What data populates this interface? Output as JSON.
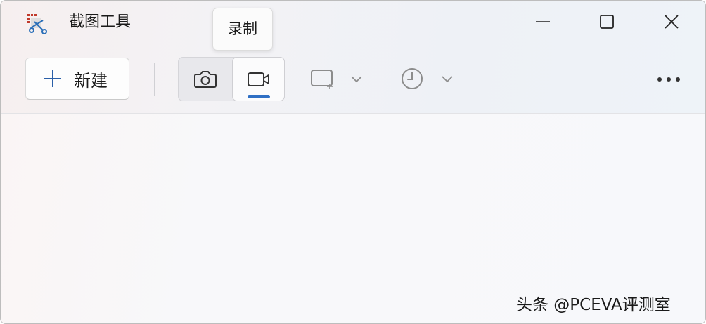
{
  "window": {
    "title": "截图工具",
    "app_icon": "snipping-tool-icon",
    "controls": {
      "minimize_icon": "minimize-icon",
      "maximize_icon": "maximize-icon",
      "close_icon": "close-icon"
    }
  },
  "tooltip": {
    "text": "录制"
  },
  "toolbar": {
    "new_label": "新建",
    "new_icon": "plus-icon",
    "mode": {
      "options": [
        {
          "name": "screenshot",
          "icon": "camera-icon",
          "selected": false
        },
        {
          "name": "record",
          "icon": "video-camera-icon",
          "selected": true
        }
      ]
    },
    "snip_shape_icon": "rectangle-snip-icon",
    "delay_icon": "clock-icon",
    "dropdown_icon": "chevron-down-icon",
    "more_icon": "more-icon"
  },
  "watermark": {
    "text": "头条 @PCEVA评测室"
  },
  "colors": {
    "accent": "#2f6fc4",
    "icon": "#333333",
    "icon_disabled": "#8c8c8c"
  }
}
